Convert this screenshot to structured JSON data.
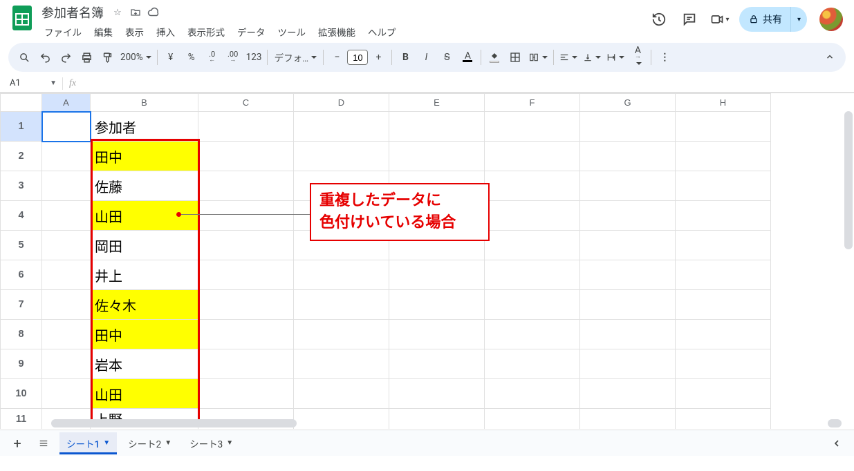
{
  "header": {
    "doc_title": "参加者名簿",
    "menus": [
      "ファイル",
      "編集",
      "表示",
      "挿入",
      "表示形式",
      "データ",
      "ツール",
      "拡張機能",
      "ヘルプ"
    ],
    "share_label": "共有"
  },
  "toolbar": {
    "zoom": "200%",
    "currency": "¥",
    "percent": "%",
    "dec_dec": ".0",
    "inc_dec": ".00",
    "format_123": "123",
    "font": "デフォ…",
    "font_size": "10"
  },
  "fx": {
    "name_box": "A1",
    "formula": ""
  },
  "columns": [
    "",
    "A",
    "B",
    "C",
    "D",
    "E",
    "F",
    "G",
    "H"
  ],
  "rows": [
    {
      "n": "1",
      "a": "",
      "b": "参加者",
      "hl": false
    },
    {
      "n": "2",
      "a": "",
      "b": "田中",
      "hl": true
    },
    {
      "n": "3",
      "a": "",
      "b": "佐藤",
      "hl": false
    },
    {
      "n": "4",
      "a": "",
      "b": "山田",
      "hl": true
    },
    {
      "n": "5",
      "a": "",
      "b": "岡田",
      "hl": false
    },
    {
      "n": "6",
      "a": "",
      "b": "井上",
      "hl": false
    },
    {
      "n": "7",
      "a": "",
      "b": "佐々木",
      "hl": true
    },
    {
      "n": "8",
      "a": "",
      "b": "田中",
      "hl": true
    },
    {
      "n": "9",
      "a": "",
      "b": "岩本",
      "hl": false
    },
    {
      "n": "10",
      "a": "",
      "b": "山田",
      "hl": true
    },
    {
      "n": "11",
      "a": "",
      "b": "上野",
      "hl": false
    }
  ],
  "annotation": {
    "line1": "重複したデータに",
    "line2": "色付けいている場合"
  },
  "tabs": {
    "items": [
      "シート1",
      "シート2",
      "シート3"
    ],
    "active_index": 0
  }
}
